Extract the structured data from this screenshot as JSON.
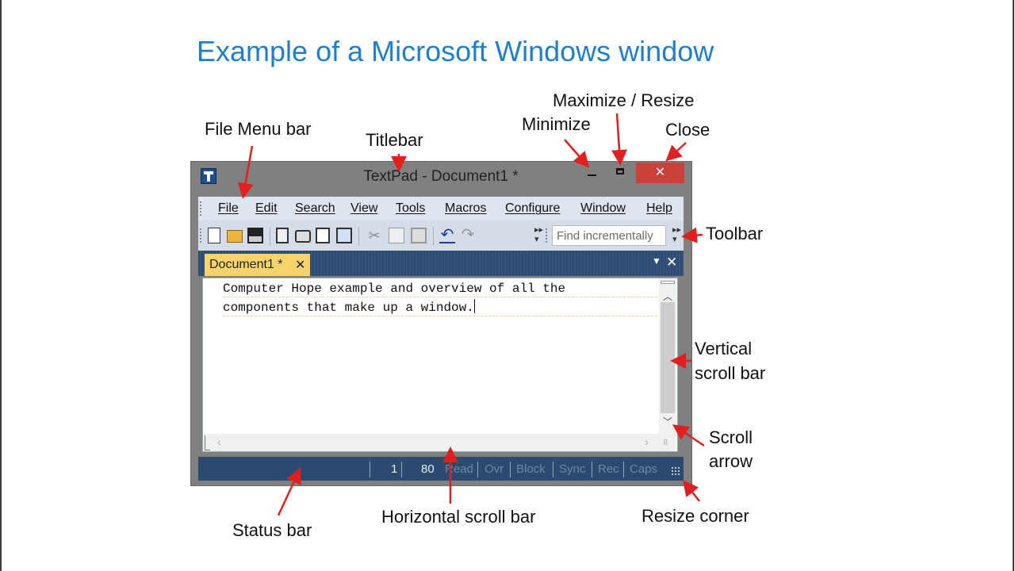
{
  "slide": {
    "title": "Example of a Microsoft Windows window"
  },
  "callouts": {
    "maximize_resize": "Maximize / Resize",
    "minimize": "Minimize",
    "close": "Close",
    "file_menu_bar": "File Menu bar",
    "titlebar": "Titlebar",
    "toolbar": "Toolbar",
    "vertical_scroll_1": "Vertical",
    "vertical_scroll_2": "scroll bar",
    "scroll_arrow_1": "Scroll",
    "scroll_arrow_2": "arrow",
    "status_bar": "Status bar",
    "horizontal_scroll_bar": "Horizontal scroll bar",
    "resize_corner": "Resize corner"
  },
  "window": {
    "title": "TextPad - Document1 *",
    "close_glyph": "✕",
    "menu": [
      "File",
      "Edit",
      "Search",
      "View",
      "Tools",
      "Macros",
      "Configure",
      "Window",
      "Help"
    ],
    "find_placeholder": "Find incrementally",
    "tab": {
      "label": "Document1 *",
      "close_glyph": "✕"
    },
    "editor_lines": [
      "Computer Hope example and overview of all the",
      "components that make up a window."
    ],
    "status": {
      "line": "1",
      "col": "80",
      "read": "Read",
      "ovr": "Ovr",
      "block": "Block",
      "sync": "Sync",
      "rec": "Rec",
      "caps": "Caps"
    }
  },
  "colors": {
    "title_blue": "#1f7fce",
    "arrow_red": "#e02020",
    "close_button": "#c9413a",
    "status_bar": "#2a4a70",
    "tab_yellow": "#f6d46b"
  }
}
